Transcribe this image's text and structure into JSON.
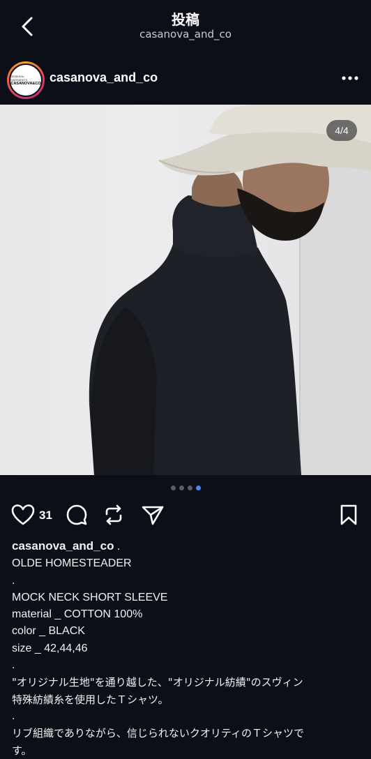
{
  "header": {
    "title": "投稿",
    "subtitle": "casanova_and_co"
  },
  "post": {
    "username": "casanova_and_co",
    "avatar_text_top": "GENERAL GARMENTS",
    "avatar_text_main": "CASANOVA&CO",
    "image_counter": "4/4",
    "dots_total": 4,
    "dots_active_index": 3,
    "like_count": "31"
  },
  "icons": {
    "back": "chevron-left-icon",
    "more": "more-horizontal-icon",
    "like": "heart-icon",
    "comment": "comment-icon",
    "repost": "repost-icon",
    "share": "send-icon",
    "save": "bookmark-icon"
  },
  "caption": {
    "username": "casanova_and_co",
    "username_suffix": " .",
    "lines": [
      "OLDE HOMESTEADER",
      ".",
      "MOCK NECK SHORT SLEEVE",
      "material _ COTTON 100%",
      "color _ BLACK",
      "size _ 42,44,46",
      ".",
      "\"オリジナル生地\"を通り越した、\"オリジナル紡績\"のスヴィン",
      "特殊紡績糸を使用したＴシャツ。",
      ".",
      "リブ組織でありながら、信じられないクオリティのＴシャツで",
      "す。"
    ]
  },
  "colors": {
    "background": "#0c0f18",
    "accent_dot": "#4a8bf5",
    "text": "#f2f2f2"
  }
}
